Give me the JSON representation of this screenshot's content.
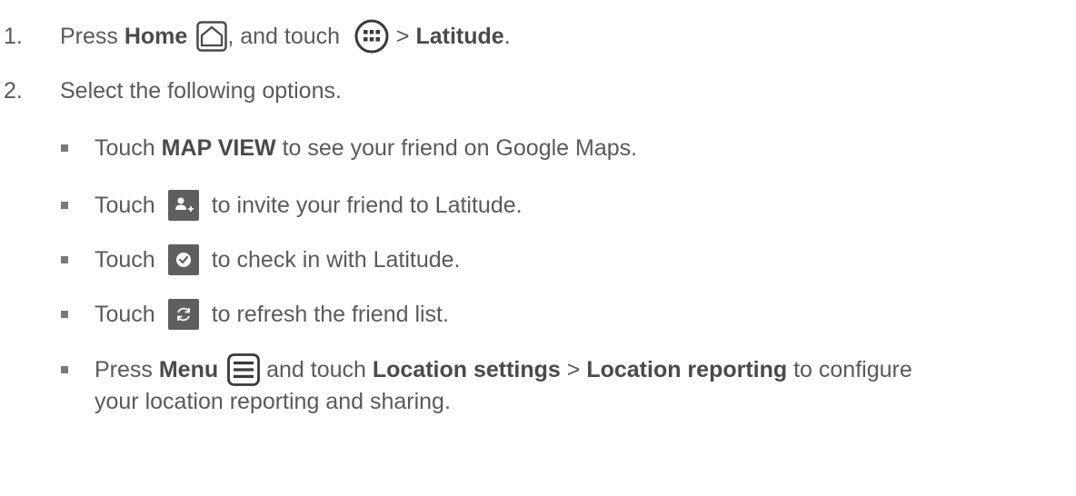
{
  "steps": [
    {
      "number": "1.",
      "parts": {
        "a": "Press ",
        "home": "Home",
        "b": ", and touch ",
        "c": " > ",
        "latitude": "Latitude",
        "d": "."
      }
    },
    {
      "number": "2.",
      "text": "Select the following options."
    }
  ],
  "bullets": {
    "map_view": {
      "a": "Touch ",
      "bold": "MAP VIEW",
      "b": " to see your friend on Google Maps."
    },
    "invite": {
      "a": "Touch",
      "b": "to invite your friend to Latitude."
    },
    "checkin": {
      "a": "Touch",
      "b": "to check in with Latitude."
    },
    "refresh": {
      "a": "Touch",
      "b": "to refresh the friend list."
    },
    "menu": {
      "a": "Press ",
      "menu": "Menu",
      "b": " and touch ",
      "loc_settings": "Location settings",
      "c": " > ",
      "loc_reporting": "Location reporting",
      "d": " to configure",
      "e": "your location reporting and sharing."
    }
  },
  "icons": {
    "home": "home-key-icon",
    "apps": "apps-launcher-icon",
    "add_friend": "add-friend-icon",
    "checkin": "check-in-icon",
    "refresh": "refresh-icon",
    "menu": "menu-key-icon"
  },
  "colors": {
    "text": "#5a5a5a",
    "icon_tile": "#5f5f5f"
  }
}
